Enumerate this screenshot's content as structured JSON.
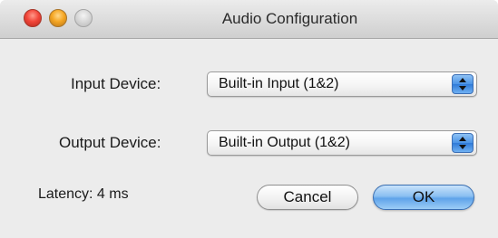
{
  "window": {
    "title": "Audio Configuration"
  },
  "title_bar": {
    "buttons": [
      {
        "name": "close",
        "color": "#f2463a"
      },
      {
        "name": "minimize",
        "color": "#f5a623"
      },
      {
        "name": "zoom",
        "color": "#d6d6d6"
      }
    ]
  },
  "form": {
    "input_device": {
      "label": "Input Device:",
      "selected": "Built-in Input (1&2)"
    },
    "output_device": {
      "label": "Output Device:",
      "selected": "Built-in Output (1&2)"
    }
  },
  "footer": {
    "latency": "Latency: 4 ms",
    "cancel_label": "Cancel",
    "ok_label": "OK"
  },
  "colors": {
    "accent": "#4a93e6",
    "window_background": "#ececec"
  }
}
